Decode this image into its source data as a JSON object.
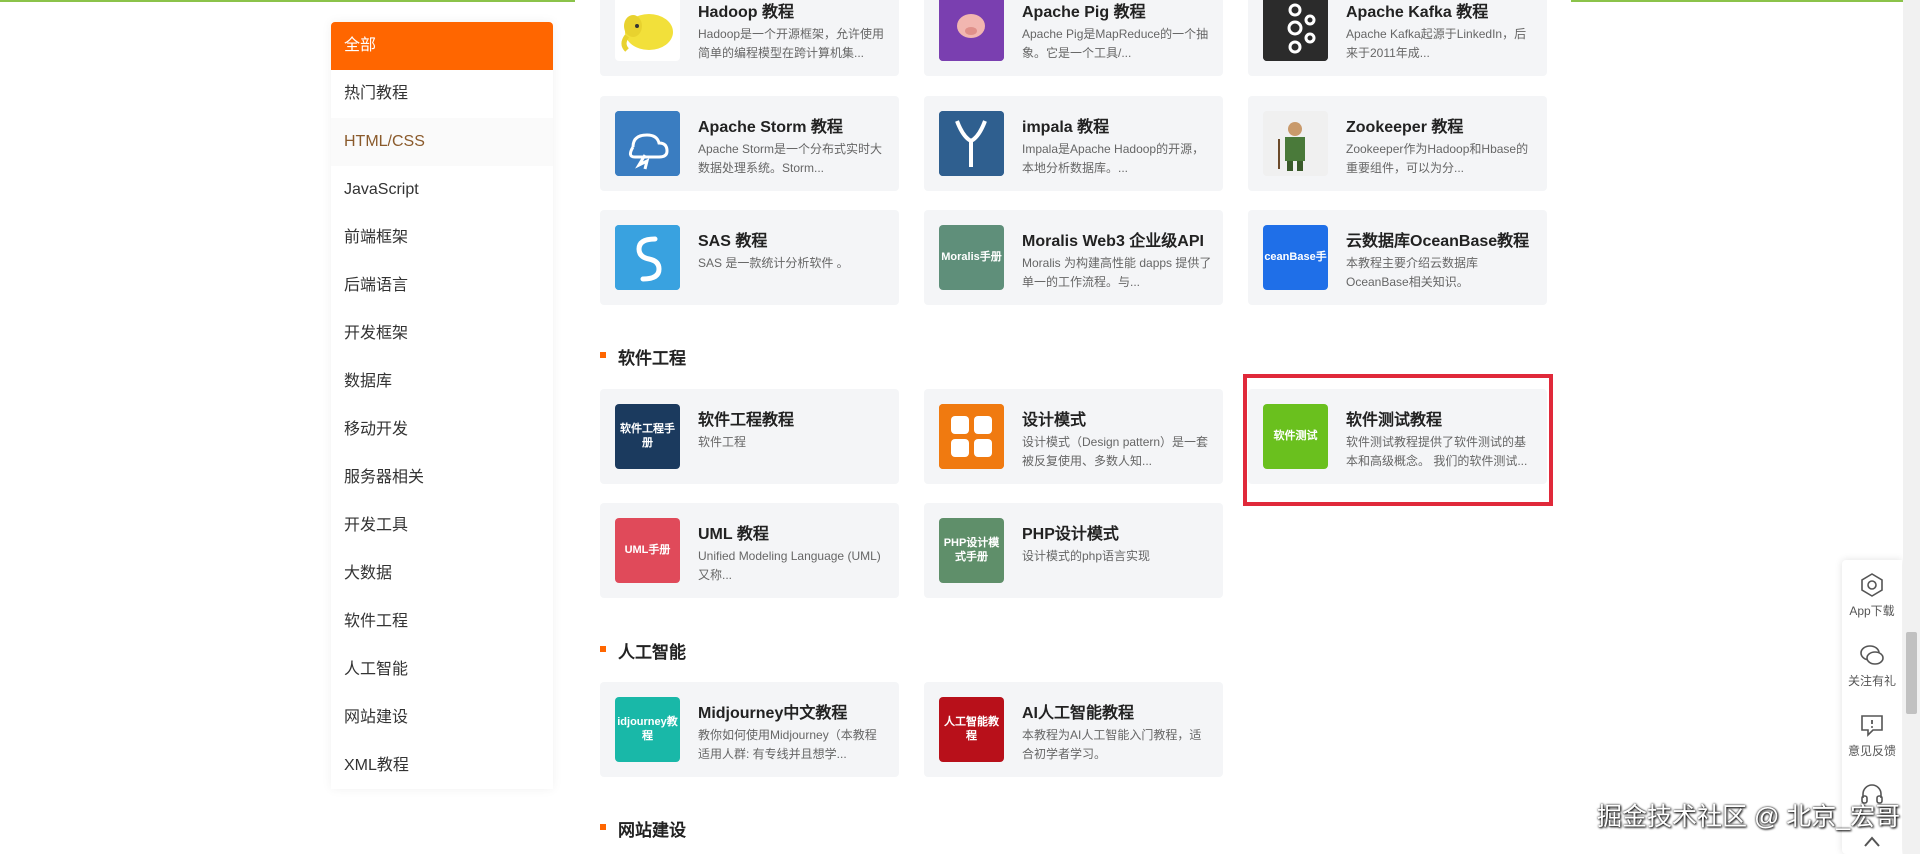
{
  "sidebar": {
    "items": [
      {
        "label": "全部"
      },
      {
        "label": "热门教程"
      },
      {
        "label": "HTML/CSS"
      },
      {
        "label": "JavaScript"
      },
      {
        "label": "前端框架"
      },
      {
        "label": "后端语言"
      },
      {
        "label": "开发框架"
      },
      {
        "label": "数据库"
      },
      {
        "label": "移动开发"
      },
      {
        "label": "服务器相关"
      },
      {
        "label": "开发工具"
      },
      {
        "label": "大数据"
      },
      {
        "label": "软件工程"
      },
      {
        "label": "人工智能"
      },
      {
        "label": "网站建设"
      },
      {
        "label": "XML教程"
      }
    ]
  },
  "bigdata_cards": [
    {
      "title": "Hadoop 教程",
      "desc": "Hadoop是一个开源框架，允许使用简单的编程模型在跨计算机集...",
      "thumb_color": "#f5f5f5"
    },
    {
      "title": "Apache Pig 教程",
      "desc": "Apache Pig是MapReduce的一个抽象。它是一个工具/...",
      "thumb_color": "#7a3fb0"
    },
    {
      "title": "Apache Kafka 教程",
      "desc": "Apache Kafka起源于LinkedIn，后来于2011年成...",
      "thumb_color": "#2b2b2b"
    },
    {
      "title": "Apache Storm 教程",
      "desc": "Apache Storm是一个分布式实时大数据处理系统。Storm...",
      "thumb_color": "#3a7dc1"
    },
    {
      "title": "impala 教程",
      "desc": "Impala是Apache Hadoop的开源，本地分析数据库。...",
      "thumb_color": "#2f5f8f"
    },
    {
      "title": "Zookeeper 教程",
      "desc": "Zookeeper作为Hadoop和Hbase的重要组件，可以为分...",
      "thumb_color": "#f0f0f0"
    },
    {
      "title": "SAS 教程",
      "desc": "SAS 是一款统计分析软件 。",
      "thumb_color": "#39a2e0"
    },
    {
      "title": "Moralis Web3 企业级API",
      "desc": "Moralis 为构建高性能 dapps 提供了单一的工作流程。与...",
      "thumb_text": "Moralis手册",
      "thumb_color": "#5f8f7a"
    },
    {
      "title": "云数据库OceanBase教程",
      "desc": "本教程主要介绍云数据库OceanBase相关知识。",
      "thumb_text": "ceanBase手",
      "thumb_color": "#1f6fe8"
    }
  ],
  "sections": {
    "software_engineering": "软件工程",
    "ai": "人工智能",
    "website": "网站建设"
  },
  "se_cards": [
    {
      "title": "软件工程教程",
      "desc": "软件工程",
      "thumb_text": "软件工程手册",
      "thumb_color": "#1b3a5e"
    },
    {
      "title": "设计模式",
      "desc": "设计模式（Design pattern）是一套被反复使用、多数人知...",
      "thumb_color": "#f07a10"
    },
    {
      "title": "软件测试教程",
      "desc": "软件测试教程提供了软件测试的基本和高级概念。 我们的软件测试...",
      "thumb_text": "软件测试",
      "thumb_color": "#6ac01e"
    },
    {
      "title": "UML 教程",
      "desc": "Unified Modeling Language (UML)又称...",
      "thumb_text": "UML手册",
      "thumb_color": "#e04a5a"
    },
    {
      "title": "PHP设计模式",
      "desc": "设计模式的php语言实现",
      "thumb_text": "PHP设计模式手册",
      "thumb_color": "#5f8f6a"
    }
  ],
  "ai_cards": [
    {
      "title": "Midjourney中文教程",
      "desc": "教你如何使用Midjourney（本教程适用人群: 有专线并且想学...",
      "thumb_text": "idjourney教程",
      "thumb_color": "#19b8a8"
    },
    {
      "title": "AI人工智能教程",
      "desc": "本教程为AI人工智能入门教程，适合初学者学习。",
      "thumb_text": "人工智能教程",
      "thumb_color": "#b8101a"
    }
  ],
  "float_bar": {
    "app_download": "App下载",
    "follow": "关注有礼",
    "feedback": "意见反馈"
  },
  "watermark": "掘金技术社区 @ 北京_宏哥"
}
